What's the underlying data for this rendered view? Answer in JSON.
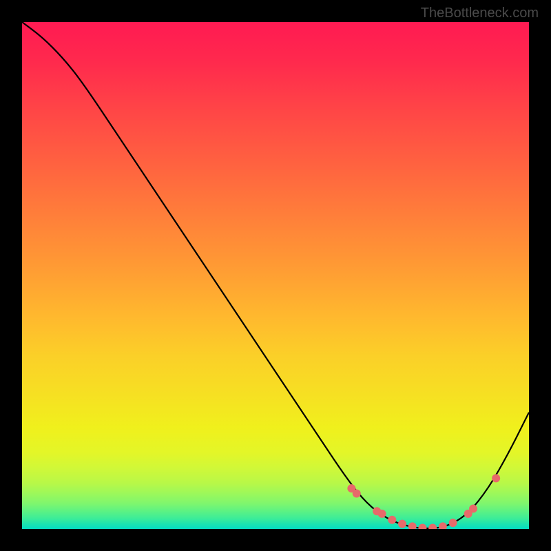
{
  "watermark": "TheBottleneck.com",
  "chart_data": {
    "type": "line",
    "title": "",
    "xlabel": "",
    "ylabel": "",
    "xlim": [
      0,
      100
    ],
    "ylim": [
      0,
      100
    ],
    "series": [
      {
        "name": "curve",
        "points": [
          {
            "x": 0,
            "y": 100
          },
          {
            "x": 4,
            "y": 97
          },
          {
            "x": 8,
            "y": 93
          },
          {
            "x": 12,
            "y": 88
          },
          {
            "x": 20,
            "y": 76
          },
          {
            "x": 30,
            "y": 61
          },
          {
            "x": 40,
            "y": 46
          },
          {
            "x": 50,
            "y": 31
          },
          {
            "x": 58,
            "y": 19
          },
          {
            "x": 64,
            "y": 10
          },
          {
            "x": 68,
            "y": 5
          },
          {
            "x": 72,
            "y": 2
          },
          {
            "x": 76,
            "y": 0.5
          },
          {
            "x": 80,
            "y": 0
          },
          {
            "x": 84,
            "y": 0.5
          },
          {
            "x": 88,
            "y": 3
          },
          {
            "x": 92,
            "y": 8
          },
          {
            "x": 96,
            "y": 15
          },
          {
            "x": 100,
            "y": 23
          }
        ]
      }
    ],
    "markers": [
      {
        "x": 65,
        "y": 8
      },
      {
        "x": 66,
        "y": 7
      },
      {
        "x": 70,
        "y": 3.5
      },
      {
        "x": 71,
        "y": 3
      },
      {
        "x": 73,
        "y": 1.8
      },
      {
        "x": 75,
        "y": 1
      },
      {
        "x": 77,
        "y": 0.5
      },
      {
        "x": 79,
        "y": 0.2
      },
      {
        "x": 81,
        "y": 0.2
      },
      {
        "x": 83,
        "y": 0.5
      },
      {
        "x": 85,
        "y": 1.2
      },
      {
        "x": 88,
        "y": 3
      },
      {
        "x": 89,
        "y": 4
      },
      {
        "x": 93.5,
        "y": 10
      }
    ]
  }
}
